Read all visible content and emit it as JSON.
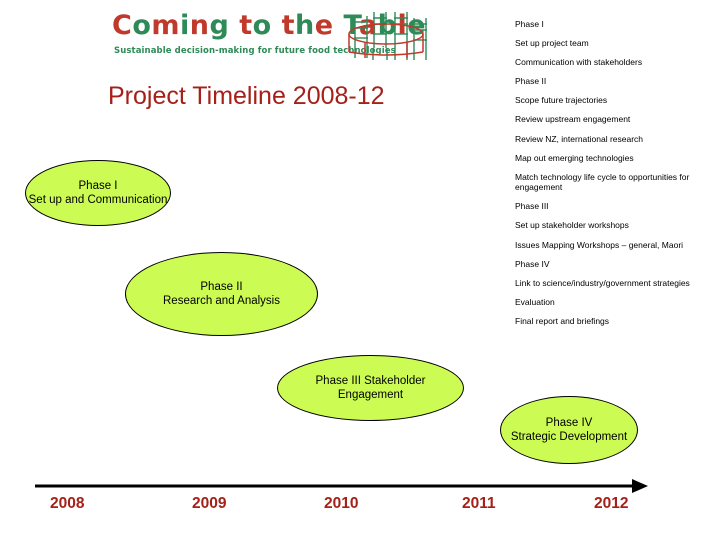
{
  "logo": {
    "wordmark": "Coming to the Table",
    "wordmark_letters": [
      {
        "c": "C",
        "color": "red"
      },
      {
        "c": "o",
        "color": "green"
      },
      {
        "c": "m",
        "color": "red"
      },
      {
        "c": "i",
        "color": "green"
      },
      {
        "c": "n",
        "color": "red"
      },
      {
        "c": "g",
        "color": "green"
      },
      {
        "c": " ",
        "color": "red"
      },
      {
        "c": "t",
        "color": "red"
      },
      {
        "c": "o",
        "color": "green"
      },
      {
        "c": " ",
        "color": "red"
      },
      {
        "c": "t",
        "color": "red"
      },
      {
        "c": "h",
        "color": "green"
      },
      {
        "c": "e",
        "color": "red"
      },
      {
        "c": " ",
        "color": "green"
      },
      {
        "c": "T",
        "color": "green"
      },
      {
        "c": "a",
        "color": "red"
      },
      {
        "c": "b",
        "color": "green"
      },
      {
        "c": "l",
        "color": "red"
      },
      {
        "c": "e",
        "color": "green"
      }
    ],
    "tagline": "Sustainable decision-making for future food technologies",
    "graphic_name": "round-table-with-chairs",
    "red": "#c0392b",
    "green": "#2e8b57"
  },
  "title": "Project Timeline 2008-12",
  "title_color": "#a52019",
  "phase_list": [
    "Phase I",
    "Set up project team",
    "Communication with stakeholders",
    "Phase II",
    "Scope future trajectories",
    "Review upstream engagement",
    "Review NZ, international research",
    "Map out emerging technologies",
    "Match technology life cycle to opportunities for engagement",
    "Phase III",
    "Set up stakeholder workshops",
    "Issues Mapping Workshops – general, Maori",
    "Phase IV",
    "Link to science/industry/government strategies",
    "Evaluation",
    "Final report and briefings"
  ],
  "ellipses": [
    {
      "line1": "Phase I",
      "line2": "Set up and Communication"
    },
    {
      "line1": "Phase II",
      "line2": "Research and Analysis"
    },
    {
      "line1": "Phase III Stakeholder",
      "line2": "Engagement"
    },
    {
      "line1": "Phase IV",
      "line2": "Strategic Development"
    }
  ],
  "ellipse_fill": "#ccfc53",
  "timeline": {
    "years": [
      "2008",
      "2009",
      "2010",
      "2011",
      "2012"
    ],
    "year_color": "#a52019",
    "axis_name": "arrow-right"
  }
}
